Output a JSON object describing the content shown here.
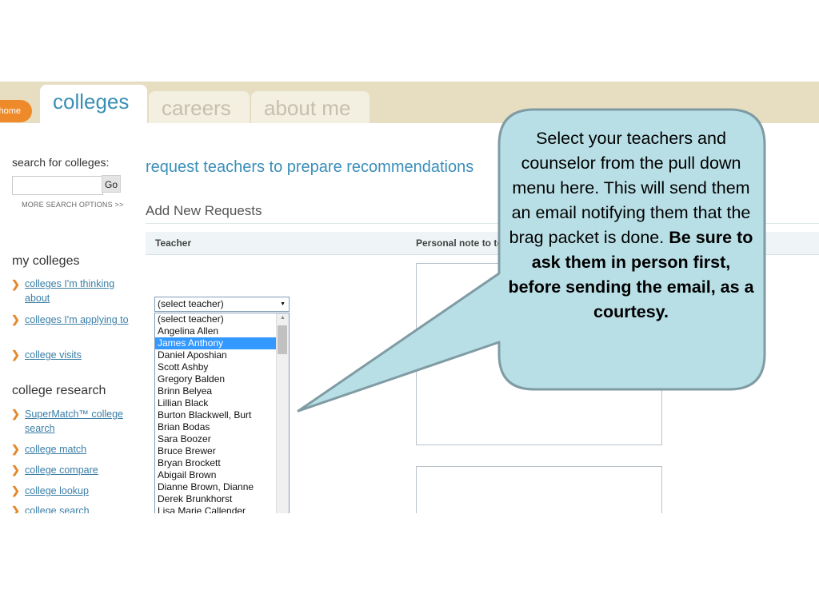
{
  "tabs": {
    "home": "home",
    "colleges": "colleges",
    "careers": "careers",
    "about_me": "about me"
  },
  "sidebar": {
    "search_label": "search for colleges:",
    "search_placeholder": "",
    "go_label": "Go",
    "more_options": "MORE SEARCH OPTIONS >>",
    "my_colleges": {
      "heading": "my colleges",
      "items": [
        {
          "label": "colleges I'm thinking about"
        },
        {
          "label": "colleges I'm applying to"
        },
        {
          "label": "college visits"
        }
      ]
    },
    "college_research": {
      "heading": "college research",
      "items": [
        {
          "label": "SuperMatch™ college search"
        },
        {
          "label": "college match"
        },
        {
          "label": "college compare"
        },
        {
          "label": "college lookup"
        },
        {
          "label": "college search"
        }
      ]
    }
  },
  "main": {
    "title": "request teachers to prepare recommendations",
    "section_title": "Add New Requests",
    "table": {
      "col_teacher": "Teacher",
      "col_note": "Personal note to teacher"
    },
    "select": {
      "selected_value": "(select teacher)",
      "highlighted": "James Anthony",
      "options": [
        "(select teacher)",
        "Angelina Allen",
        "James Anthony",
        "Daniel Aposhian",
        "Scott Ashby",
        "Gregory Balden",
        "Brinn Belyea",
        "Lillian Black",
        "Burton Blackwell, Burt",
        "Brian Bodas",
        "Sara Boozer",
        "Bruce Brewer",
        "Bryan Brockett",
        "Abigail Brown",
        "Dianne Brown, Dianne",
        "Derek Brunkhorst",
        "Lisa Marie Callender"
      ]
    }
  },
  "callout": {
    "line_normal": "Select your teachers and counselor from the pull down menu here. This will send them an email notifying them that the brag packet is done.",
    "line_bold": "Be sure to ask them in person first, before sending the email, as a courtesy.",
    "fill_color": "#b9dfe6",
    "stroke_color": "#7f9ba3"
  }
}
